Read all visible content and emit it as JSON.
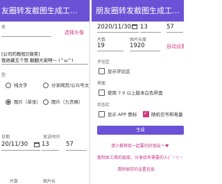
{
  "left_panel": {
    "title": "友圈转发截图生成工...",
    "name_label_tail": "名",
    "avatar_link": "选择头像",
    "content_line1": "[公司的教程][微笑]",
    "content_line2": "我收藏五个赞 翻翻大家啊～ (^ω^)",
    "type_label": "型",
    "opt_text": "纯文字",
    "opt_share": "分享网页/公众号文",
    "opt_img_single": "图片（单张）",
    "opt_img_grid": "图片（九宫格）",
    "date_label": "日期",
    "time_label": "发送时间",
    "date_value": "20/11/30",
    "hour_value": "13",
    "minute_value": "57",
    "bottom_label1": "片数",
    "bottom_label2": "图片长"
  },
  "right_panel": {
    "title": "朋友圈转发截图生成工...",
    "date_value": "2020/11/30",
    "hour_value": "13",
    "minute_value": "57",
    "label_count": "片数",
    "label_length": "图片长度",
    "count_value": "19",
    "length_value": "1920",
    "auto_link": "自动设置",
    "comment_section": "评论区",
    "show_comment": "显示评论区",
    "interface_section": "界面",
    "use_white_style": "使用 7.0 以上版本白色界面",
    "status_section": "状态栏",
    "show_app_icon": "显示 APP 图标",
    "random_signal": "随机信号和电量",
    "generate_button": "生成",
    "link_share": "请小推荐给一起要的好朋友～♥",
    "link_copy": "复制本工具的链接，分享给有需要的人(´・▽・`)",
    "link_clear": "清除保存的设置信息"
  }
}
